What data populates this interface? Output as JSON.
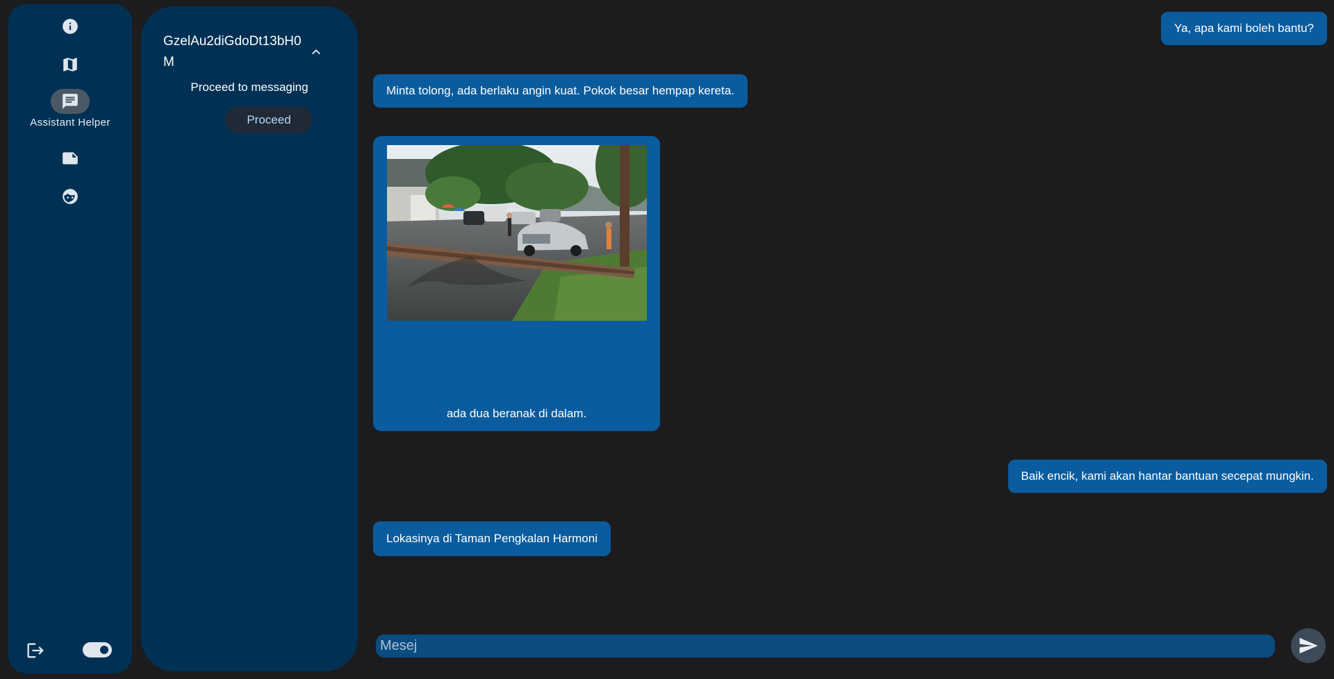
{
  "nav": {
    "items": [
      {
        "icon": "info-icon",
        "label": ""
      },
      {
        "icon": "map-icon",
        "label": ""
      },
      {
        "icon": "chat-icon",
        "label": "Assistant Helper",
        "active": true
      },
      {
        "icon": "note-icon",
        "label": ""
      },
      {
        "icon": "face-icon",
        "label": ""
      }
    ],
    "logout_icon": "logout-icon",
    "theme_toggle": "on"
  },
  "case_panel": {
    "title": "GzelAu2diGdoDt13bH0M",
    "subtitle": "Proceed to messaging",
    "proceed_label": "Proceed",
    "collapse_icon": "chevron-up-icon"
  },
  "messages": [
    {
      "side": "right",
      "text": "Ya, apa kami boleh bantu?"
    },
    {
      "side": "left",
      "text": "Minta tolong, ada berlaku angin kuat. Pokok besar hempap kereta."
    },
    {
      "side": "left",
      "type": "image",
      "caption": "ada dua beranak di dalam."
    },
    {
      "side": "right",
      "text": "Baik encik, kami akan hantar bantuan secepat mungkin."
    },
    {
      "side": "left",
      "text": "Lokasinya di Taman Pengkalan Harmoni"
    }
  ],
  "composer": {
    "placeholder": "Mesej",
    "send_icon": "send-icon"
  },
  "colors": {
    "background": "#1c1c1e",
    "panel": "#003154",
    "bubble": "#0a5c9e",
    "composer": "#0a4c80"
  }
}
